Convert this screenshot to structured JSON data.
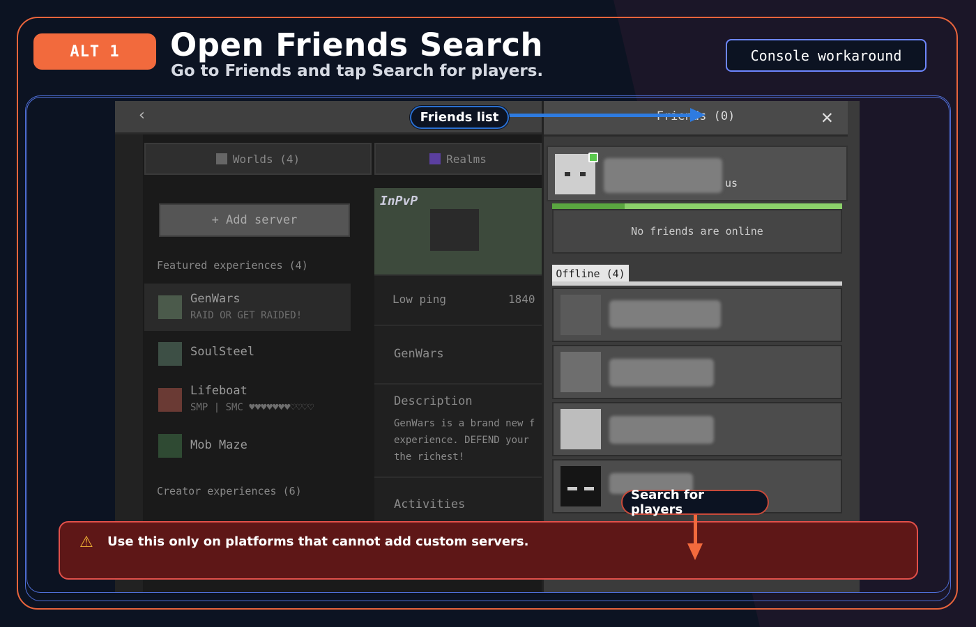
{
  "header": {
    "badge": "ALT 1",
    "title": "Open Friends Search",
    "subtitle": "Go to Friends and tap Search for players.",
    "tag": "Console workaround"
  },
  "screenshot": {
    "tabs": [
      {
        "label": "Worlds (4)",
        "icon": "world-icon"
      },
      {
        "label": "Realms",
        "icon": "realms-icon"
      }
    ],
    "add_server": "+ Add server",
    "featured_label": "Featured experiences (4)",
    "servers": [
      {
        "name": "GenWars",
        "sub": "RAID OR GET RAIDED!"
      },
      {
        "name": "SoulSteel",
        "sub": ""
      },
      {
        "name": "Lifeboat",
        "sub": "SMP | SMC ♥♥♥♥♥♥♥♡♡♡♡"
      },
      {
        "name": "Mob Maze",
        "sub": ""
      }
    ],
    "creator_label": "Creator experiences (6)",
    "detail": {
      "thumb_text": "InPvP",
      "ping": "Low ping",
      "players": "1840",
      "name": "GenWars",
      "description_label": "Description",
      "description": [
        "GenWars is a brand new f",
        "experience. DEFEND your",
        "the richest!"
      ],
      "activities_label": "Activities"
    },
    "friends_panel": {
      "title": "Friends (0)",
      "me_status": "us",
      "online_progress": 0.25,
      "no_online": "No friends are online",
      "offline_tab": "Offline (4)",
      "offline_count": 4
    }
  },
  "callouts": {
    "friends_list": "Friends list",
    "search_players": "Search for players"
  },
  "warning": {
    "icon": "warning-triangle-icon",
    "text": "Use this only on platforms that cannot add custom servers."
  },
  "colors": {
    "accent_orange": "#f26a3d",
    "accent_blue": "#2e7be0",
    "warning_bg": "#5e1717"
  }
}
